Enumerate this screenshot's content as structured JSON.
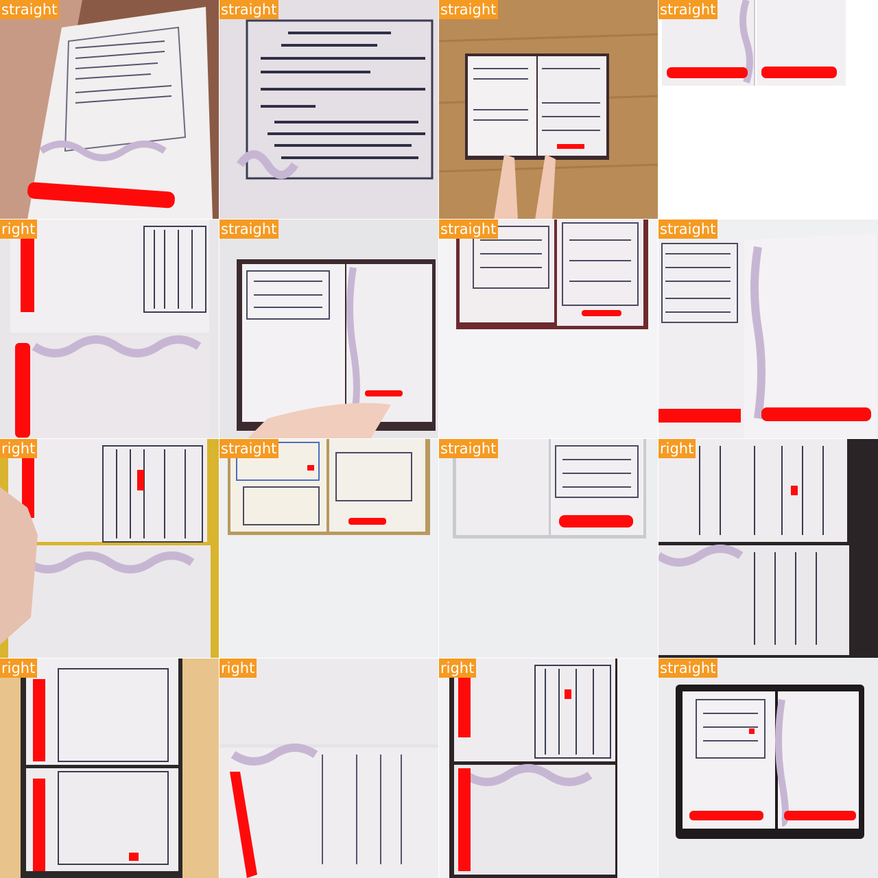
{
  "tiles": [
    {
      "label": "straight"
    },
    {
      "label": "straight"
    },
    {
      "label": "straight"
    },
    {
      "label": "straight"
    },
    {
      "label": "right"
    },
    {
      "label": "straight"
    },
    {
      "label": "straight"
    },
    {
      "label": "straight"
    },
    {
      "label": "right"
    },
    {
      "label": "straight"
    },
    {
      "label": "straight"
    },
    {
      "label": "right"
    },
    {
      "label": "right"
    },
    {
      "label": "right"
    },
    {
      "label": "right"
    },
    {
      "label": "straight"
    }
  ],
  "colors": {
    "label_bg": "#f59a22",
    "label_text": "#ffffff",
    "redaction": "#ff0a0a",
    "stamp_ink": "#3b3b52"
  }
}
